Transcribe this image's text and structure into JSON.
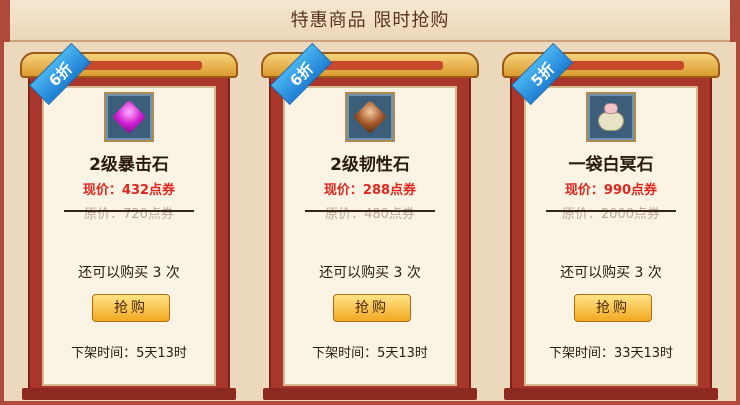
{
  "header": {
    "title": "特惠商品  限时抢购"
  },
  "colors": {
    "accent_red": "#e0261e",
    "frame_red": "#a8362a",
    "ribbon_blue": "#1f7fd3",
    "button_gold": "#f2a822"
  },
  "cards": [
    {
      "discount": "6折",
      "icon": "purple-gem-icon",
      "name": "2级暴击石",
      "price_now": "现价：432点券",
      "price_old": "原价：720点券",
      "remaining": "还可以购买 3 次",
      "buy_label": "抢购",
      "offline": "下架时间：5天13时"
    },
    {
      "discount": "6折",
      "icon": "brown-gem-icon",
      "name": "2级韧性石",
      "price_now": "现价：288点券",
      "price_old": "原价：480点券",
      "remaining": "还可以购买 3 次",
      "buy_label": "抢购",
      "offline": "下架时间：5天13时"
    },
    {
      "discount": "5折",
      "icon": "stone-bag-icon",
      "name": "一袋白冥石",
      "price_now": "现价：990点券",
      "price_old": "原价：2000点券",
      "remaining": "还可以购买 3 次",
      "buy_label": "抢购",
      "offline": "下架时间：33天13时"
    }
  ]
}
